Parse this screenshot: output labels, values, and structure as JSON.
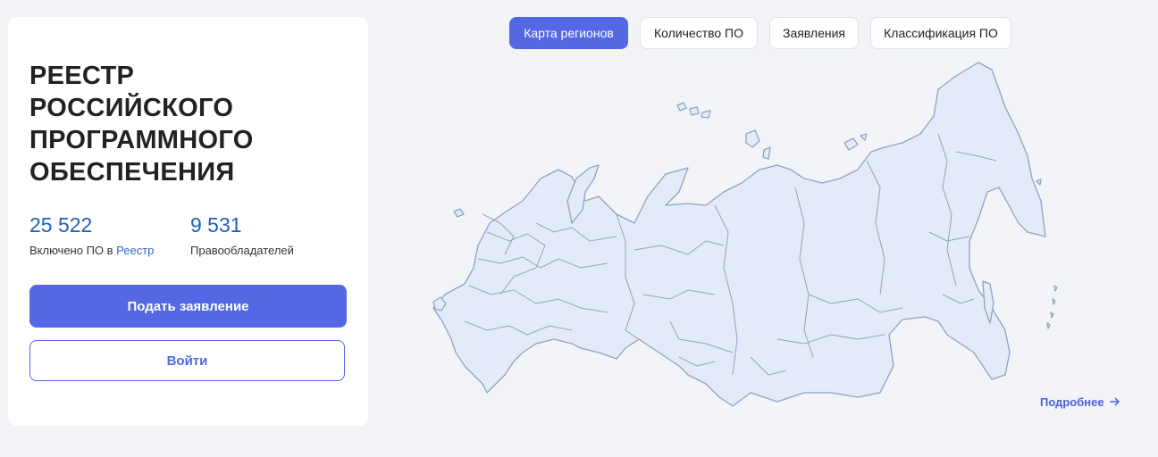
{
  "registry": {
    "title": "РЕЕСТР РОССИЙСКОГО ПРОГРАММНОГО ОБЕСПЕЧЕНИЯ",
    "stats": [
      {
        "value": "25 522",
        "label_prefix": "Включено ПО в ",
        "label_link": "Реестр"
      },
      {
        "value": "9 531",
        "label": "Правообладателей"
      }
    ],
    "apply_label": "Подать заявление",
    "login_label": "Войти"
  },
  "tabs": [
    {
      "label": "Карта регионов",
      "active": true
    },
    {
      "label": "Количество ПО",
      "active": false
    },
    {
      "label": "Заявления",
      "active": false
    },
    {
      "label": "Классификация ПО",
      "active": false
    }
  ],
  "more_label": "Подробнее",
  "colors": {
    "accent": "#5368e2",
    "map_fill": "#e3ebf8",
    "map_stroke": "#8ea3c4",
    "stat_number": "#1f5fbf"
  }
}
